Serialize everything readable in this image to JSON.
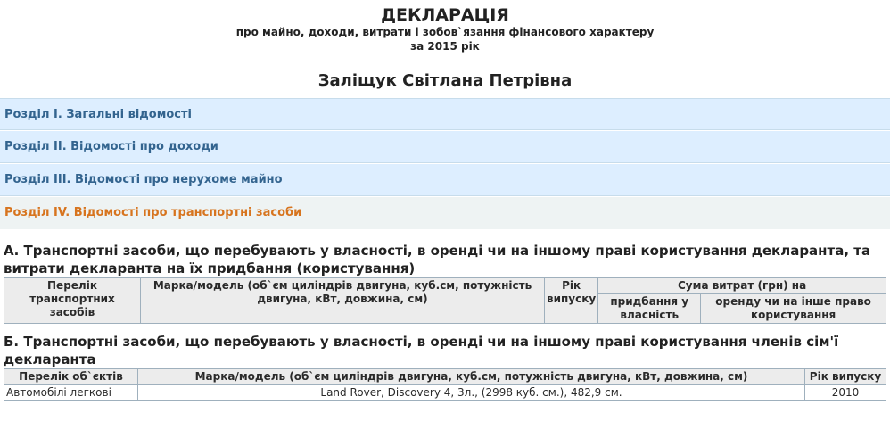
{
  "header": {
    "title": "ДЕКЛАРАЦІЯ",
    "subtitle": "про майно, доходи, витрати і зобов`язання фінансового характеру",
    "year": "за 2015 рік",
    "person": "Заліщук Світлана Петрівна"
  },
  "sections": [
    {
      "label": "Розділ I. Загальні відомості"
    },
    {
      "label": "Розділ II. Відомості про доходи"
    },
    {
      "label": "Розділ III. Відомості про нерухоме майно"
    },
    {
      "label": "Розділ IV. Відомості про транспортні засоби"
    }
  ],
  "part_a": {
    "heading": "А. Транспортні засоби, що перебувають у власності, в оренді чи на іншому праві користування декларанта, та витрати декларанта на їх придбання (користування)",
    "col_list": "Перелік транспортних засобів",
    "col_model": "Марка/модель (об`єм циліндрів двигуна, куб.см, потужність двигуна, кВт, довжина, см)",
    "col_year": "Рік випуску",
    "col_sum": "Сума витрат (грн) на",
    "col_purchase": "придбання у власність",
    "col_rent": "оренду чи на інше право користування"
  },
  "part_b": {
    "heading": "Б. Транспортні засоби, що перебувають у власності, в оренді чи на іншому праві користування членів сім'ї декларанта",
    "col_list": "Перелік об`єктів",
    "col_model": "Марка/модель (об`єм циліндрів двигуна, куб.см, потужність двигуна, кВт, довжина, см)",
    "col_year": "Рік випуску",
    "rows": [
      {
        "type": "Автомобілі легкові",
        "model": "Land Rover, Discovery 4, 3л., (2998 куб. см.), 482,9 см.",
        "year": "2010"
      }
    ]
  }
}
